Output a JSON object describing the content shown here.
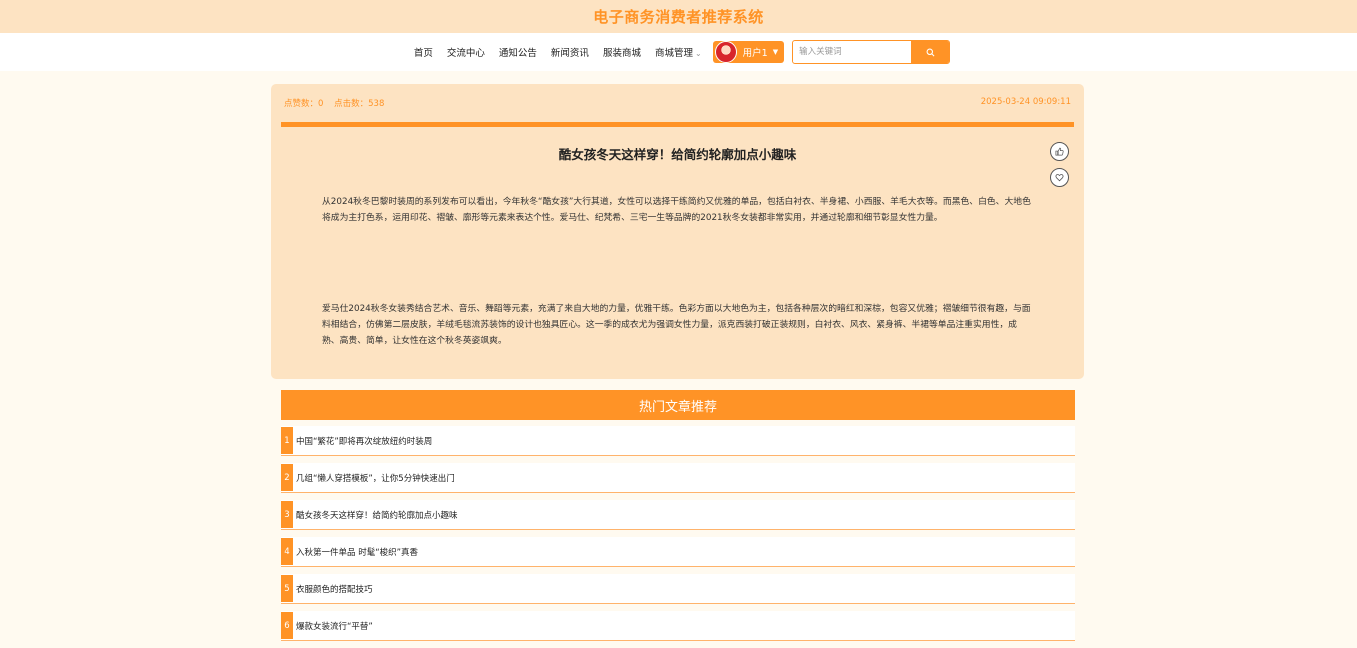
{
  "header": {
    "site_title": "电子商务消费者推荐系统"
  },
  "nav": {
    "items": [
      {
        "label": "首页"
      },
      {
        "label": "交流中心"
      },
      {
        "label": "通知公告"
      },
      {
        "label": "新闻资讯"
      },
      {
        "label": "服装商城"
      },
      {
        "label": "商城管理"
      }
    ],
    "user_label": "用户1",
    "search": {
      "placeholder": "输入关键词",
      "value": ""
    }
  },
  "article": {
    "likes_label": "点赞数：0",
    "clicks_label": "点击数：538",
    "datetime": "2025-03-24 09:09:11",
    "title": "酷女孩冬天这样穿！给简约轮廓加点小趣味",
    "paragraphs": [
      "从2024秋冬巴黎时装周的系列发布可以看出，今年秋冬“酷女孩”大行其道，女性可以选择干练简约又优雅的单品，包括白衬衣、半身裙、小西服、羊毛大衣等。而黑色、白色、大地色将成为主打色系，运用印花、褶皱、廓形等元素来表达个性。爱马仕、纪梵希、三宅一生等品牌的2021秋冬女装都非常实用，并通过轮廓和细节彰显女性力量。",
      "爱马仕2024秋冬女装秀结合艺术、音乐、舞蹈等元素，充满了来自大地的力量，优雅干练。色彩方面以大地色为主，包括各种层次的暗红和深棕，包容又优雅；褶皱细节很有趣，与面料相结合，仿佛第二层皮肤，羊绒毛毯流苏装饰的设计也独具匠心。这一季的成衣尤为强调女性力量，派克西装打破正装规则，白衬衣、风衣、紧身裤、半裙等单品注重实用性，成熟、高贵、简单，让女性在这个秋冬英姿飒爽。"
    ]
  },
  "hot": {
    "title": "热门文章推荐",
    "items": [
      {
        "num": "1",
        "text": "中国“繁花”即将再次绽放纽约时装周"
      },
      {
        "num": "2",
        "text": "几组“懒人穿搭模板”，让你5分钟快速出门"
      },
      {
        "num": "3",
        "text": "酷女孩冬天这样穿！给简约轮廓加点小趣味"
      },
      {
        "num": "4",
        "text": "入秋第一件单品 时髦“梭织”真香"
      },
      {
        "num": "5",
        "text": "衣服颜色的搭配技巧"
      },
      {
        "num": "6",
        "text": "爆款女装流行“平替”"
      }
    ]
  },
  "colors": {
    "accent": "#ff9326",
    "panel": "#fde3c2",
    "page_bg": "#fffaf0"
  }
}
